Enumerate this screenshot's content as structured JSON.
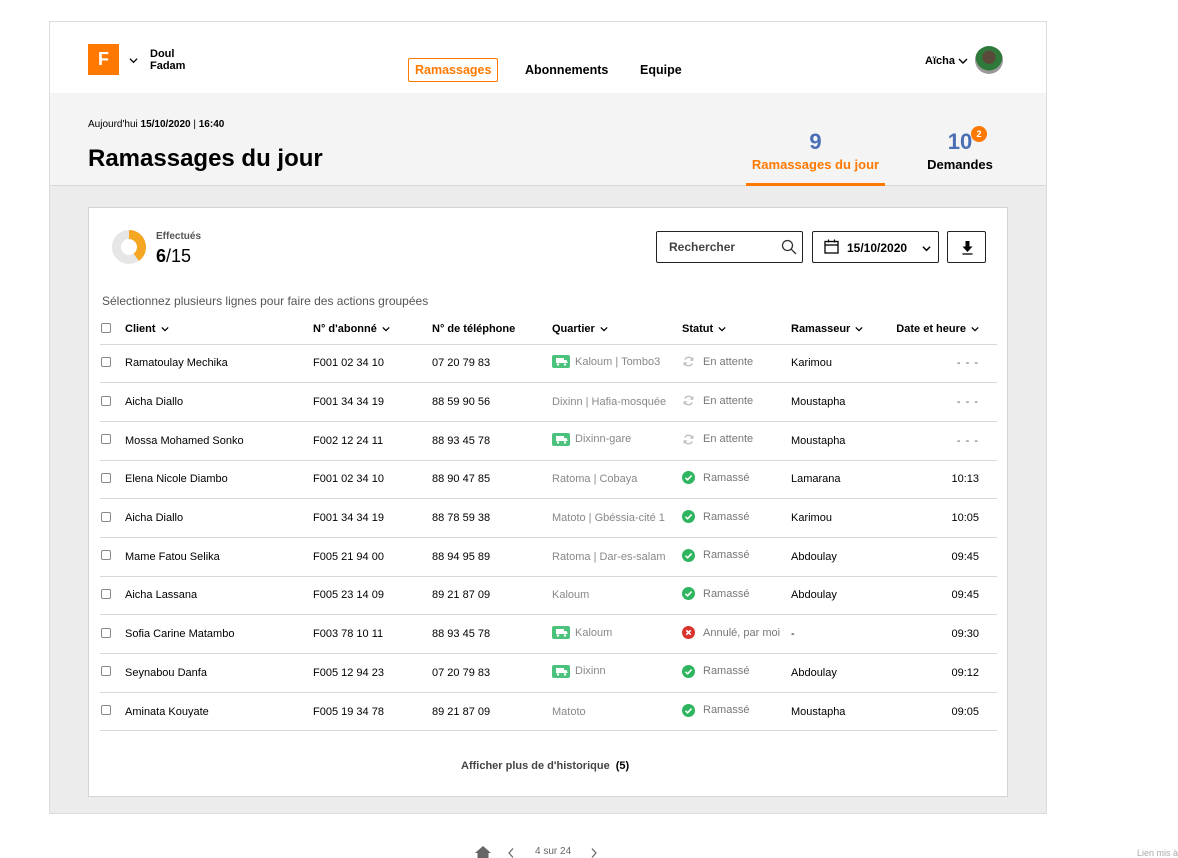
{
  "brand": {
    "logo_letter": "F",
    "company_line1": "Doul",
    "company_line2": "Fadam",
    "accent_color": "#ff7900"
  },
  "nav": {
    "items": [
      "Ramassages",
      "Abonnements",
      "Equipe"
    ]
  },
  "user": {
    "name": "Aïcha"
  },
  "header": {
    "today_label": "Aujourd'hui",
    "today_date": "15/10/2020",
    "today_time": "16:40",
    "title": "Ramassages du jour",
    "stats": [
      {
        "value": "9",
        "label": "Ramassages du jour"
      },
      {
        "value": "10",
        "label": "Demandes",
        "badge": "2"
      }
    ]
  },
  "summary": {
    "label": "Effectués",
    "done": "6",
    "total": "/15",
    "progress": 0.4
  },
  "toolbar": {
    "search_placeholder": "Rechercher",
    "date": "15/10/2020"
  },
  "table": {
    "hint": "Sélectionnez plusieurs lignes pour faire des actions groupées",
    "headers": [
      "Client",
      "N° d'abonné",
      "N° de téléphone",
      "Quartier",
      "Statut",
      "Ramasseur",
      "Date et heure"
    ],
    "rows": [
      {
        "client": "Ramatoulay Mechika",
        "abonne": "F001 02 34 10",
        "tel": "07 20 79 83",
        "quartier": "Kaloum | Tombo3",
        "truck": true,
        "statut": "En attente",
        "status_type": "wait",
        "ramasseur": "Karimou",
        "time": "- - -"
      },
      {
        "client": "Aicha Diallo",
        "abonne": "F001 34 34 19",
        "tel": "88 59 90 56",
        "quartier": "Dixinn | Hafia-mosquée",
        "truck": false,
        "statut": "En attente",
        "status_type": "wait",
        "ramasseur": "Moustapha",
        "time": "- - -"
      },
      {
        "client": "Mossa Mohamed Sonko",
        "abonne": "F002 12 24 11",
        "tel": "88 93 45 78",
        "quartier": "Dixinn-gare",
        "truck": true,
        "statut": "En attente",
        "status_type": "wait",
        "ramasseur": "Moustapha",
        "time": "- - -"
      },
      {
        "client": "Elena Nicole Diambo",
        "abonne": "F001 02 34 10",
        "tel": "88 90 47 85",
        "quartier": "Ratoma | Cobaya",
        "truck": false,
        "statut": "Ramassé",
        "status_type": "ok",
        "ramasseur": "Lamarana",
        "time": "10:13"
      },
      {
        "client": "Aicha Diallo",
        "abonne": "F001 34 34 19",
        "tel": "88 78 59 38",
        "quartier": "Matoto | Gbéssia-cité 1",
        "truck": false,
        "statut": "Ramassé",
        "status_type": "ok",
        "ramasseur": "Karimou",
        "time": "10:05"
      },
      {
        "client": "Mame Fatou Selika",
        "abonne": "F005 21 94 00",
        "tel": "88 94 95 89",
        "quartier": "Ratoma | Dar-es-salam",
        "truck": false,
        "statut": "Ramassé",
        "status_type": "ok",
        "ramasseur": "Abdoulay",
        "time": "09:45"
      },
      {
        "client": "Aicha Lassana",
        "abonne": "F005 23 14 09",
        "tel": "89 21 87 09",
        "quartier": "Kaloum",
        "truck": false,
        "statut": "Ramassé",
        "status_type": "ok",
        "ramasseur": "Abdoulay",
        "time": "09:45"
      },
      {
        "client": "Sofia Carine Matambo",
        "abonne": "F003 78 10 11",
        "tel": "88 93 45 78",
        "quartier": "Kaloum",
        "truck": true,
        "statut": "Annulé, par moi",
        "status_type": "cancel",
        "ramasseur": "-",
        "time": "09:30"
      },
      {
        "client": "Seynabou Danfa",
        "abonne": "F005 12 94 23",
        "tel": "07 20 79 83",
        "quartier": "Dixinn",
        "truck": true,
        "statut": "Ramassé",
        "status_type": "ok",
        "ramasseur": "Abdoulay",
        "time": "09:12"
      },
      {
        "client": "Aminata Kouyate",
        "abonne": "F005 19 34 78",
        "tel": "89 21 87 09",
        "quartier": "Matoto",
        "truck": false,
        "statut": "Ramassé",
        "status_type": "ok",
        "ramasseur": "Moustapha",
        "time": "09:05"
      }
    ],
    "more_label": "Afficher plus de d'historique",
    "more_count": "(5)"
  },
  "pager": {
    "label": "4 sur 24"
  },
  "corner_text": "Lien mis à"
}
